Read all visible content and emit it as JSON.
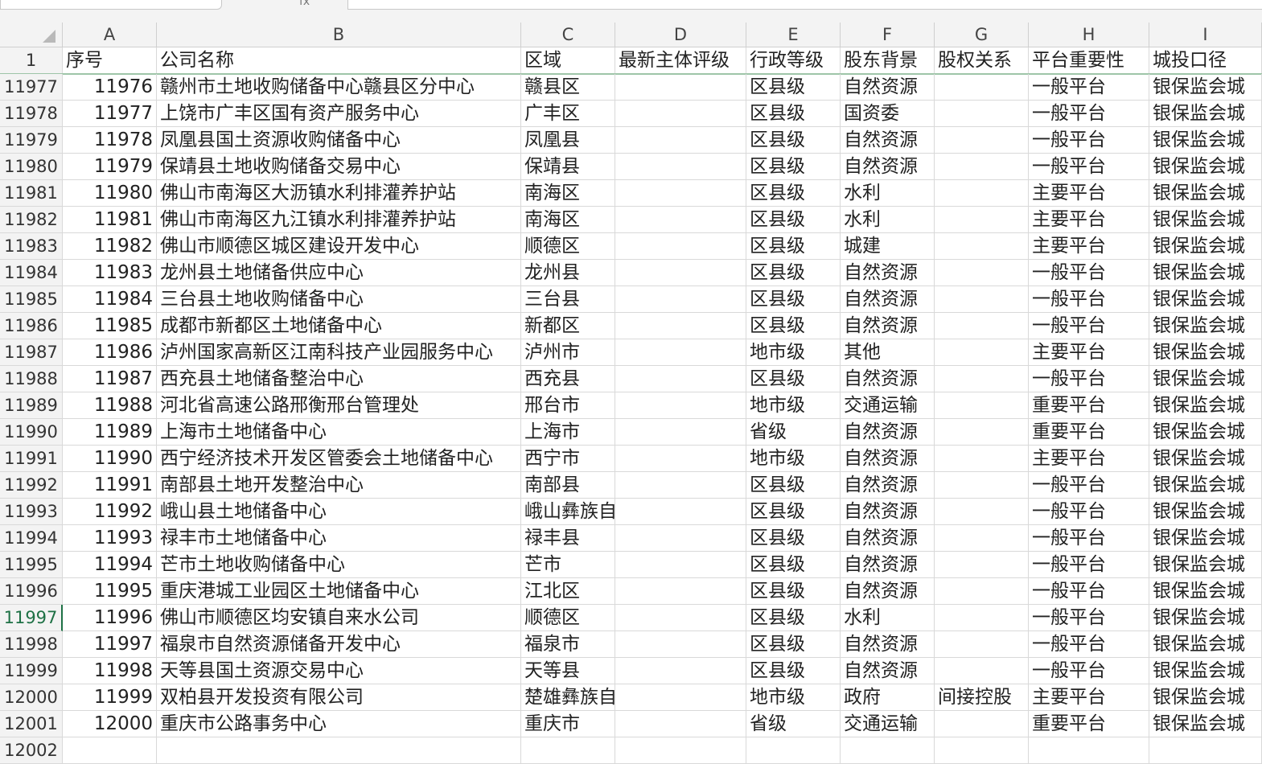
{
  "formula_bar": {
    "fx_label": "fx"
  },
  "columns": [
    "A",
    "B",
    "C",
    "D",
    "E",
    "F",
    "G",
    "H",
    "I"
  ],
  "header_row": {
    "row_number": "1",
    "cells": [
      "序号",
      "公司名称",
      "区域",
      "最新主体评级",
      "行政等级",
      "股东背景",
      "股权关系",
      "平台重要性",
      "城投口径"
    ]
  },
  "active_row": "11997",
  "rows": [
    {
      "r": "11977",
      "c": [
        "11976",
        "赣州市土地收购储备中心赣县区分中心",
        "赣县区",
        "",
        "区县级",
        "自然资源",
        "",
        "一般平台",
        "银保监会城"
      ]
    },
    {
      "r": "11978",
      "c": [
        "11977",
        "上饶市广丰区国有资产服务中心",
        "广丰区",
        "",
        "区县级",
        "国资委",
        "",
        "一般平台",
        "银保监会城"
      ]
    },
    {
      "r": "11979",
      "c": [
        "11978",
        "凤凰县国土资源收购储备中心",
        "凤凰县",
        "",
        "区县级",
        "自然资源",
        "",
        "一般平台",
        "银保监会城"
      ]
    },
    {
      "r": "11980",
      "c": [
        "11979",
        "保靖县土地收购储备交易中心",
        "保靖县",
        "",
        "区县级",
        "自然资源",
        "",
        "一般平台",
        "银保监会城"
      ]
    },
    {
      "r": "11981",
      "c": [
        "11980",
        "佛山市南海区大沥镇水利排灌养护站",
        "南海区",
        "",
        "区县级",
        "水利",
        "",
        "主要平台",
        "银保监会城"
      ]
    },
    {
      "r": "11982",
      "c": [
        "11981",
        "佛山市南海区九江镇水利排灌养护站",
        "南海区",
        "",
        "区县级",
        "水利",
        "",
        "主要平台",
        "银保监会城"
      ]
    },
    {
      "r": "11983",
      "c": [
        "11982",
        "佛山市顺德区城区建设开发中心",
        "顺德区",
        "",
        "区县级",
        "城建",
        "",
        "主要平台",
        "银保监会城"
      ]
    },
    {
      "r": "11984",
      "c": [
        "11983",
        "龙州县土地储备供应中心",
        "龙州县",
        "",
        "区县级",
        "自然资源",
        "",
        "一般平台",
        "银保监会城"
      ]
    },
    {
      "r": "11985",
      "c": [
        "11984",
        "三台县土地收购储备中心",
        "三台县",
        "",
        "区县级",
        "自然资源",
        "",
        "一般平台",
        "银保监会城"
      ]
    },
    {
      "r": "11986",
      "c": [
        "11985",
        "成都市新都区土地储备中心",
        "新都区",
        "",
        "区县级",
        "自然资源",
        "",
        "一般平台",
        "银保监会城"
      ]
    },
    {
      "r": "11987",
      "c": [
        "11986",
        "泸州国家高新区江南科技产业园服务中心",
        "泸州市",
        "",
        "地市级",
        "其他",
        "",
        "主要平台",
        "银保监会城"
      ]
    },
    {
      "r": "11988",
      "c": [
        "11987",
        "西充县土地储备整治中心",
        "西充县",
        "",
        "区县级",
        "自然资源",
        "",
        "一般平台",
        "银保监会城"
      ]
    },
    {
      "r": "11989",
      "c": [
        "11988",
        "河北省高速公路邢衡邢台管理处",
        "邢台市",
        "",
        "地市级",
        "交通运输",
        "",
        "重要平台",
        "银保监会城"
      ]
    },
    {
      "r": "11990",
      "c": [
        "11989",
        "上海市土地储备中心",
        "上海市",
        "",
        "省级",
        "自然资源",
        "",
        "重要平台",
        "银保监会城"
      ]
    },
    {
      "r": "11991",
      "c": [
        "11990",
        "西宁经济技术开发区管委会土地储备中心",
        "西宁市",
        "",
        "地市级",
        "自然资源",
        "",
        "主要平台",
        "银保监会城"
      ]
    },
    {
      "r": "11992",
      "c": [
        "11991",
        "南部县土地开发整治中心",
        "南部县",
        "",
        "区县级",
        "自然资源",
        "",
        "一般平台",
        "银保监会城"
      ]
    },
    {
      "r": "11993",
      "c": [
        "11992",
        "峨山县土地储备中心",
        "峨山彝族自治县",
        "",
        "区县级",
        "自然资源",
        "",
        "一般平台",
        "银保监会城"
      ]
    },
    {
      "r": "11994",
      "c": [
        "11993",
        "禄丰市土地储备中心",
        "禄丰县",
        "",
        "区县级",
        "自然资源",
        "",
        "一般平台",
        "银保监会城"
      ]
    },
    {
      "r": "11995",
      "c": [
        "11994",
        "芒市土地收购储备中心",
        "芒市",
        "",
        "区县级",
        "自然资源",
        "",
        "一般平台",
        "银保监会城"
      ]
    },
    {
      "r": "11996",
      "c": [
        "11995",
        "重庆港城工业园区土地储备中心",
        "江北区",
        "",
        "区县级",
        "自然资源",
        "",
        "一般平台",
        "银保监会城"
      ]
    },
    {
      "r": "11997",
      "c": [
        "11996",
        "佛山市顺德区均安镇自来水公司",
        "顺德区",
        "",
        "区县级",
        "水利",
        "",
        "一般平台",
        "银保监会城"
      ]
    },
    {
      "r": "11998",
      "c": [
        "11997",
        "福泉市自然资源储备开发中心",
        "福泉市",
        "",
        "区县级",
        "自然资源",
        "",
        "一般平台",
        "银保监会城"
      ]
    },
    {
      "r": "11999",
      "c": [
        "11998",
        "天等县国土资源交易中心",
        "天等县",
        "",
        "区县级",
        "自然资源",
        "",
        "一般平台",
        "银保监会城"
      ]
    },
    {
      "r": "12000",
      "c": [
        "11999",
        "双柏县开发投资有限公司",
        "楚雄彝族自治州",
        "",
        "地市级",
        "政府",
        "间接控股",
        "主要平台",
        "银保监会城"
      ]
    },
    {
      "r": "12001",
      "c": [
        "12000",
        "重庆市公路事务中心",
        "重庆市",
        "",
        "省级",
        "交通运输",
        "",
        "重要平台",
        "银保监会城"
      ]
    },
    {
      "r": "12002",
      "c": [
        "",
        "",
        "",
        "",
        "",
        "",
        "",
        "",
        ""
      ]
    }
  ]
}
